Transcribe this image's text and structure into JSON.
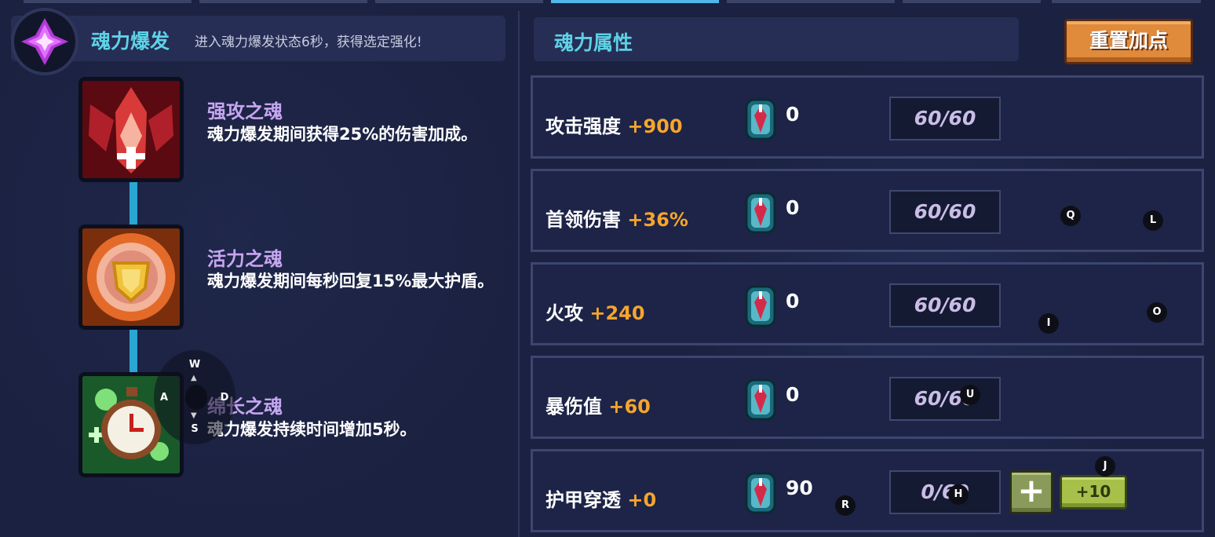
{
  "colors": {
    "accent_title": "#5fd2e6",
    "skill_name": "#c6a6f0",
    "bonus": "#f5a52e",
    "reset_button": "#e08a3c",
    "plus_button": "#8a9a5a",
    "plus10_button": "#a7c04a"
  },
  "left_header": {
    "icon": "soul-burst-crystal-icon",
    "title": "魂力爆发",
    "description": "进入魂力爆发状态6秒，获得选定强化!"
  },
  "skills": [
    {
      "icon": "strong-attack-soul-icon",
      "name": "强攻之魂",
      "description": "魂力爆发期间获得25%的伤害加成。"
    },
    {
      "icon": "vitality-soul-icon",
      "name": "活力之魂",
      "description": "魂力爆发期间每秒回复15%最大护盾。"
    },
    {
      "icon": "lasting-soul-icon",
      "name": "绵长之魂",
      "description": "魂力爆发持续时间增加5秒。"
    }
  ],
  "right_header": {
    "title": "魂力属性"
  },
  "reset_button": {
    "label": "重置加点"
  },
  "stats": [
    {
      "name": "攻击强度",
      "bonus": "+900",
      "gem_icon": "soul-gem-icon",
      "value": "0",
      "cap": "60/60"
    },
    {
      "name": "首领伤害",
      "bonus": "+36%",
      "gem_icon": "soul-gem-icon",
      "value": "0",
      "cap": "60/60"
    },
    {
      "name": "火攻",
      "bonus": "+240",
      "gem_icon": "soul-gem-icon",
      "value": "0",
      "cap": "60/60"
    },
    {
      "name": "暴伤值",
      "bonus": "+60",
      "gem_icon": "soul-gem-icon",
      "value": "0",
      "cap": "60/60"
    },
    {
      "name": "护甲穿透",
      "bonus": "+0",
      "gem_icon": "soul-gem-icon",
      "value": "90",
      "cap": "0/60",
      "plus_label": "+",
      "plus10_label": "+10"
    }
  ],
  "key_hints": {
    "dpad": {
      "up": "W",
      "left": "A",
      "center": "D",
      "down": "S"
    },
    "Q": "Q",
    "L": "L",
    "I": "I",
    "O": "O",
    "U": "U",
    "J": "J",
    "H": "H",
    "R": "R"
  }
}
